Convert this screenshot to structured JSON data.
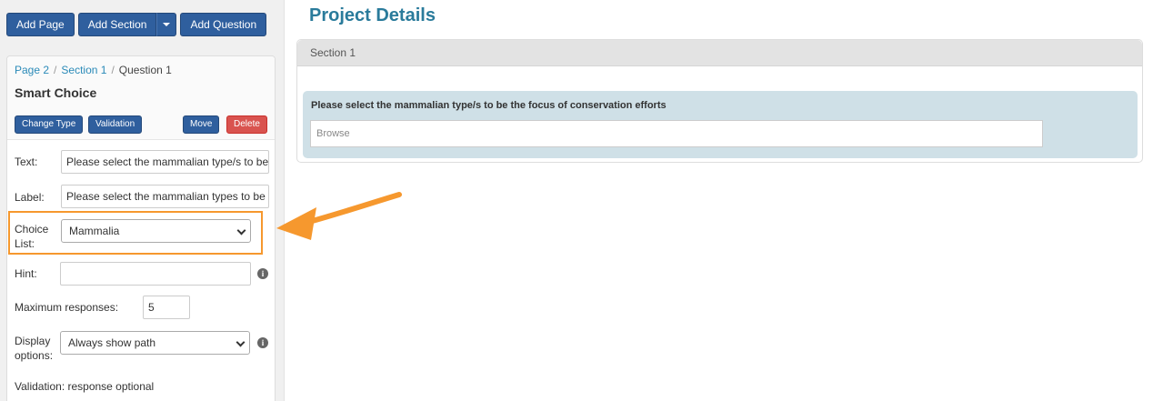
{
  "toolbar": {
    "add_page": "Add Page",
    "add_section": "Add Section",
    "add_question": "Add Question"
  },
  "breadcrumb": {
    "page": "Page 2",
    "section": "Section 1",
    "question": "Question 1",
    "separator": "/"
  },
  "editor": {
    "title": "Smart Choice",
    "buttons": {
      "change_type": "Change Type",
      "validation": "Validation",
      "move": "Move",
      "delete": "Delete"
    },
    "fields": {
      "text_label": "Text:",
      "text_value": "Please select the mammalian type/s to be the focus of conservation efforts",
      "label_label": "Label:",
      "label_value": "Please select the mammalian types to be the focus of conservation efforts",
      "choice_list_label_1": "Choice",
      "choice_list_label_2": "List:",
      "choice_list_value": "Mammalia",
      "hint_label": "Hint:",
      "hint_value": "",
      "max_responses_label": "Maximum responses:",
      "max_responses_value": "5",
      "display_options_label_1": "Display",
      "display_options_label_2": "options:",
      "display_options_value": "Always show path",
      "validation_text": "Validation: response optional"
    },
    "info_glyph": "i"
  },
  "main": {
    "title": "Project Details",
    "section_title": "Section 1",
    "question_text": "Please select the mammalian type/s to be the focus of conservation efforts",
    "browse_placeholder": "Browse"
  },
  "colors": {
    "primary_button": "#2f5f9e",
    "danger_button": "#d9534f",
    "link": "#2a8ab8",
    "title": "#2a7b9b",
    "highlight": "#f6982e",
    "question_bg": "#cfe0e7"
  }
}
